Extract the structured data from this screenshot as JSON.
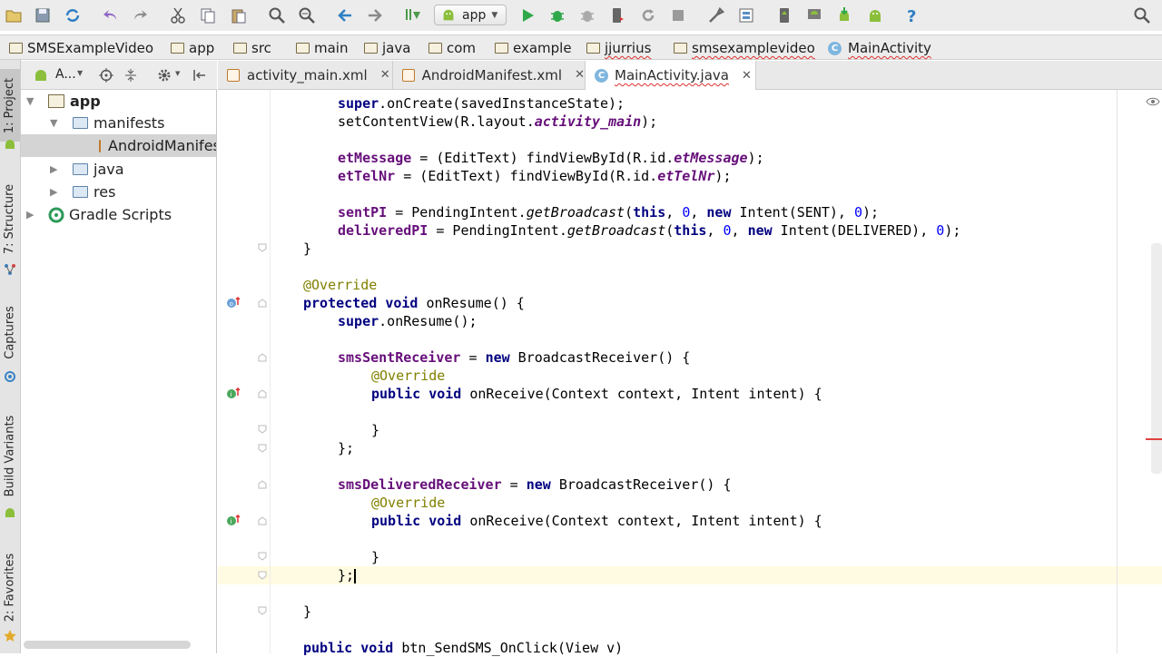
{
  "toolbar": {
    "run_config": "app",
    "icons": [
      "open-folder-icon",
      "save-icon",
      "sync-icon",
      "undo-icon",
      "redo-icon",
      "cut-icon",
      "copy-icon",
      "paste-icon",
      "find-icon",
      "replace-icon",
      "back-icon",
      "forward-icon",
      "make-icon",
      "android-run-config-icon",
      "run-icon",
      "debug-icon",
      "attach-debugger-icon",
      "apply-changes-icon",
      "rerun-icon",
      "stop-icon",
      "sdk-manager-icon",
      "project-structure-icon",
      "avd-manager-icon",
      "android-device-monitor-icon",
      "sdk-download-icon",
      "android-icon",
      "help-icon",
      "search-everywhere-icon"
    ]
  },
  "breadcrumb": [
    "SMSExampleVideo",
    "app",
    "src",
    "main",
    "java",
    "com",
    "example",
    "jjurrius",
    "smsexamplevideo",
    "MainActivity"
  ],
  "left_tool_tabs": [
    "1: Project",
    "7: Structure",
    "Captures",
    "Build Variants",
    "2: Favorites"
  ],
  "project_panel": {
    "view_selector": "A...",
    "tree": [
      {
        "label": "app",
        "expanded": true,
        "level": 0,
        "type": "module"
      },
      {
        "label": "manifests",
        "expanded": true,
        "level": 1,
        "type": "folder"
      },
      {
        "label": "AndroidManifest.xml",
        "level": 2,
        "type": "xml",
        "selected": true
      },
      {
        "label": "java",
        "expanded": false,
        "level": 1,
        "type": "folder"
      },
      {
        "label": "res",
        "expanded": false,
        "level": 1,
        "type": "folder"
      },
      {
        "label": "Gradle Scripts",
        "expanded": false,
        "level": 0,
        "type": "gradle"
      }
    ]
  },
  "editor_tabs": [
    {
      "label": "activity_main.xml",
      "active": false
    },
    {
      "label": "AndroidManifest.xml",
      "active": false
    },
    {
      "label": "MainActivity.java",
      "active": true
    }
  ],
  "code": {
    "l1a": "super",
    "l1b": ".onCreate(savedInstanceState);",
    "l2a": "setContentView(R.layout.",
    "l2b": "activity_main",
    "l2c": ");",
    "l3a": "etMessage",
    "l3b": " = (EditText) findViewById(R.id.",
    "l3c": "etMessage",
    "l3d": ");",
    "l4a": "etTelNr",
    "l4b": " = (EditText) findViewById(R.id.",
    "l4c": "etTelNr",
    "l4d": ");",
    "l5a": "sentPI",
    "l5b": " = PendingIntent.",
    "l5c": "getBroadcast",
    "l5d": "(",
    "l5e": "this",
    "l5f": ", ",
    "l5g": "0",
    "l5h": ", ",
    "l5i": "new",
    "l5j": " Intent(SENT), ",
    "l5k": "0",
    "l5l": ");",
    "l6a": "deliveredPI",
    "l6b": " = PendingIntent.",
    "l6c": "getBroadcast",
    "l6d": "(",
    "l6e": "this",
    "l6f": ", ",
    "l6g": "0",
    "l6h": ", ",
    "l6i": "new",
    "l6j": " Intent(DELIVERED), ",
    "l6k": "0",
    "l6l": ");",
    "l7": "}",
    "l8": "@Override",
    "l9a": "protected",
    "l9b": " ",
    "l9c": "void",
    "l9d": " onResume() {",
    "l10a": "super",
    "l10b": ".onResume();",
    "l11a": "smsSentReceiver",
    "l11b": " = ",
    "l11c": "new",
    "l11d": " BroadcastReceiver() {",
    "l12": "@Override",
    "l13a": "public",
    "l13b": " ",
    "l13c": "void",
    "l13d": " onReceive(Context context, Intent intent) {",
    "l14": "}",
    "l15": "};",
    "l16a": "smsDeliveredReceiver",
    "l16b": " = ",
    "l16c": "new",
    "l16d": " BroadcastReceiver() {",
    "l17": "@Override",
    "l18a": "public",
    "l18b": " ",
    "l18c": "void",
    "l18d": " onReceive(Context context, Intent intent) {",
    "l19": "}",
    "l20": "};",
    "l21": "}",
    "l22a": "public",
    "l22b": " ",
    "l22c": "void",
    "l22d": " btn_SendSMS_OnClick(View v)"
  }
}
